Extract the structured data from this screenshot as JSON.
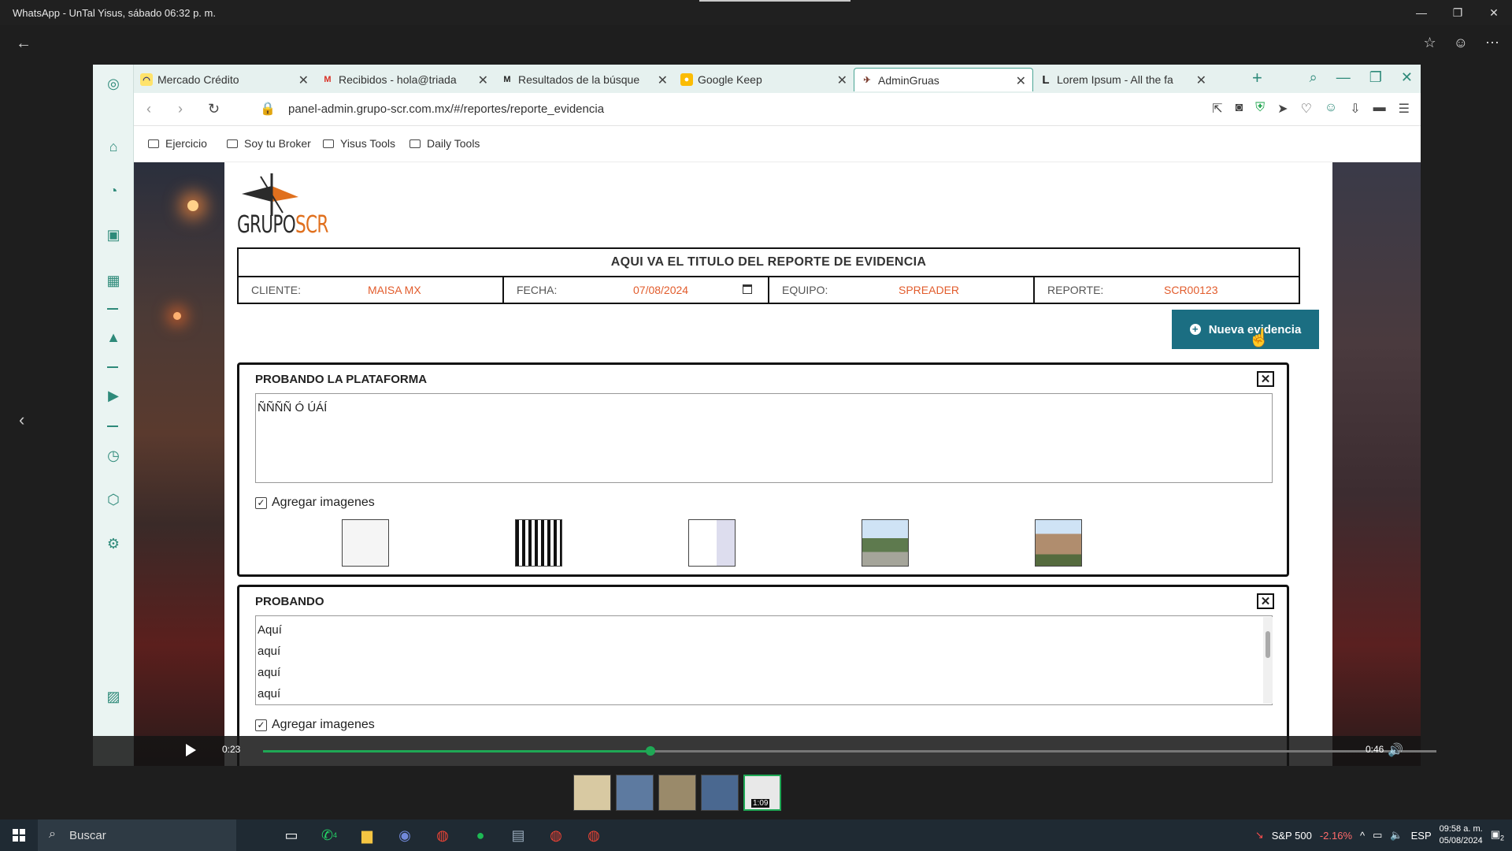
{
  "viewer": {
    "title": "WhatsApp - UnTal Yisus, sábado 06:32 p. m.",
    "video_time_current": "0:23",
    "video_time_total": "0:46",
    "video_progress": 0.33,
    "film_duration": "1:09"
  },
  "browser": {
    "tabs": [
      {
        "label": "Mercado Crédito",
        "icon": "mercado-icon"
      },
      {
        "label": "Recibidos - hola@triada",
        "icon": "gmail-icon"
      },
      {
        "label": "Resultados de la búsque",
        "icon": "search-result-icon"
      },
      {
        "label": "Google Keep",
        "icon": "keep-icon"
      },
      {
        "label": "AdminGruas",
        "icon": "admin-icon"
      },
      {
        "label": "Lorem Ipsum - All the fa",
        "icon": "lorem-icon"
      }
    ],
    "active_tab": 4,
    "url": "panel-admin.grupo-scr.com.mx/#/reportes/reporte_evidencia",
    "bookmarks": [
      "Ejercicio",
      "Soy tu Broker",
      "Yisus Tools",
      "Daily Tools"
    ]
  },
  "page": {
    "logo_text": "GRUPO",
    "logo_text_accent": "SCR",
    "report_title": "AQUI VA EL TITULO DEL REPORTE DE EVIDENCIA",
    "fields": {
      "cliente_label": "CLIENTE:",
      "cliente_value": "MAISA MX",
      "fecha_label": "FECHA:",
      "fecha_value": "07/08/2024",
      "equipo_label": "EQUIPO:",
      "equipo_value": "SPREADER",
      "reporte_label": "REPORTE:",
      "reporte_value": "SCR00123"
    },
    "new_button": "Nueva evidencia",
    "evidences": [
      {
        "title": "PROBANDO LA PLATAFORMA",
        "text": "ÑÑÑÑ Ó ÚÁÍ",
        "checkbox_label": "Agregar imagenes"
      },
      {
        "title": "PROBANDO",
        "text": "Aquí\naquí\naquí\naquí",
        "checkbox_label": "Agregar imagenes"
      }
    ],
    "close_glyph": "✕"
  },
  "taskbar": {
    "search_placeholder": "Buscar",
    "stock_name": "S&P 500",
    "stock_change": "-2.16%",
    "lang": "ESP",
    "time": "09:58 a. m.",
    "date": "05/08/2024",
    "notif_count": "2",
    "whatsapp_badge": "4"
  },
  "colors": {
    "accent": "#1b6e82",
    "value_text": "#e25c2c",
    "vivaldi": "#2e8a7a"
  }
}
